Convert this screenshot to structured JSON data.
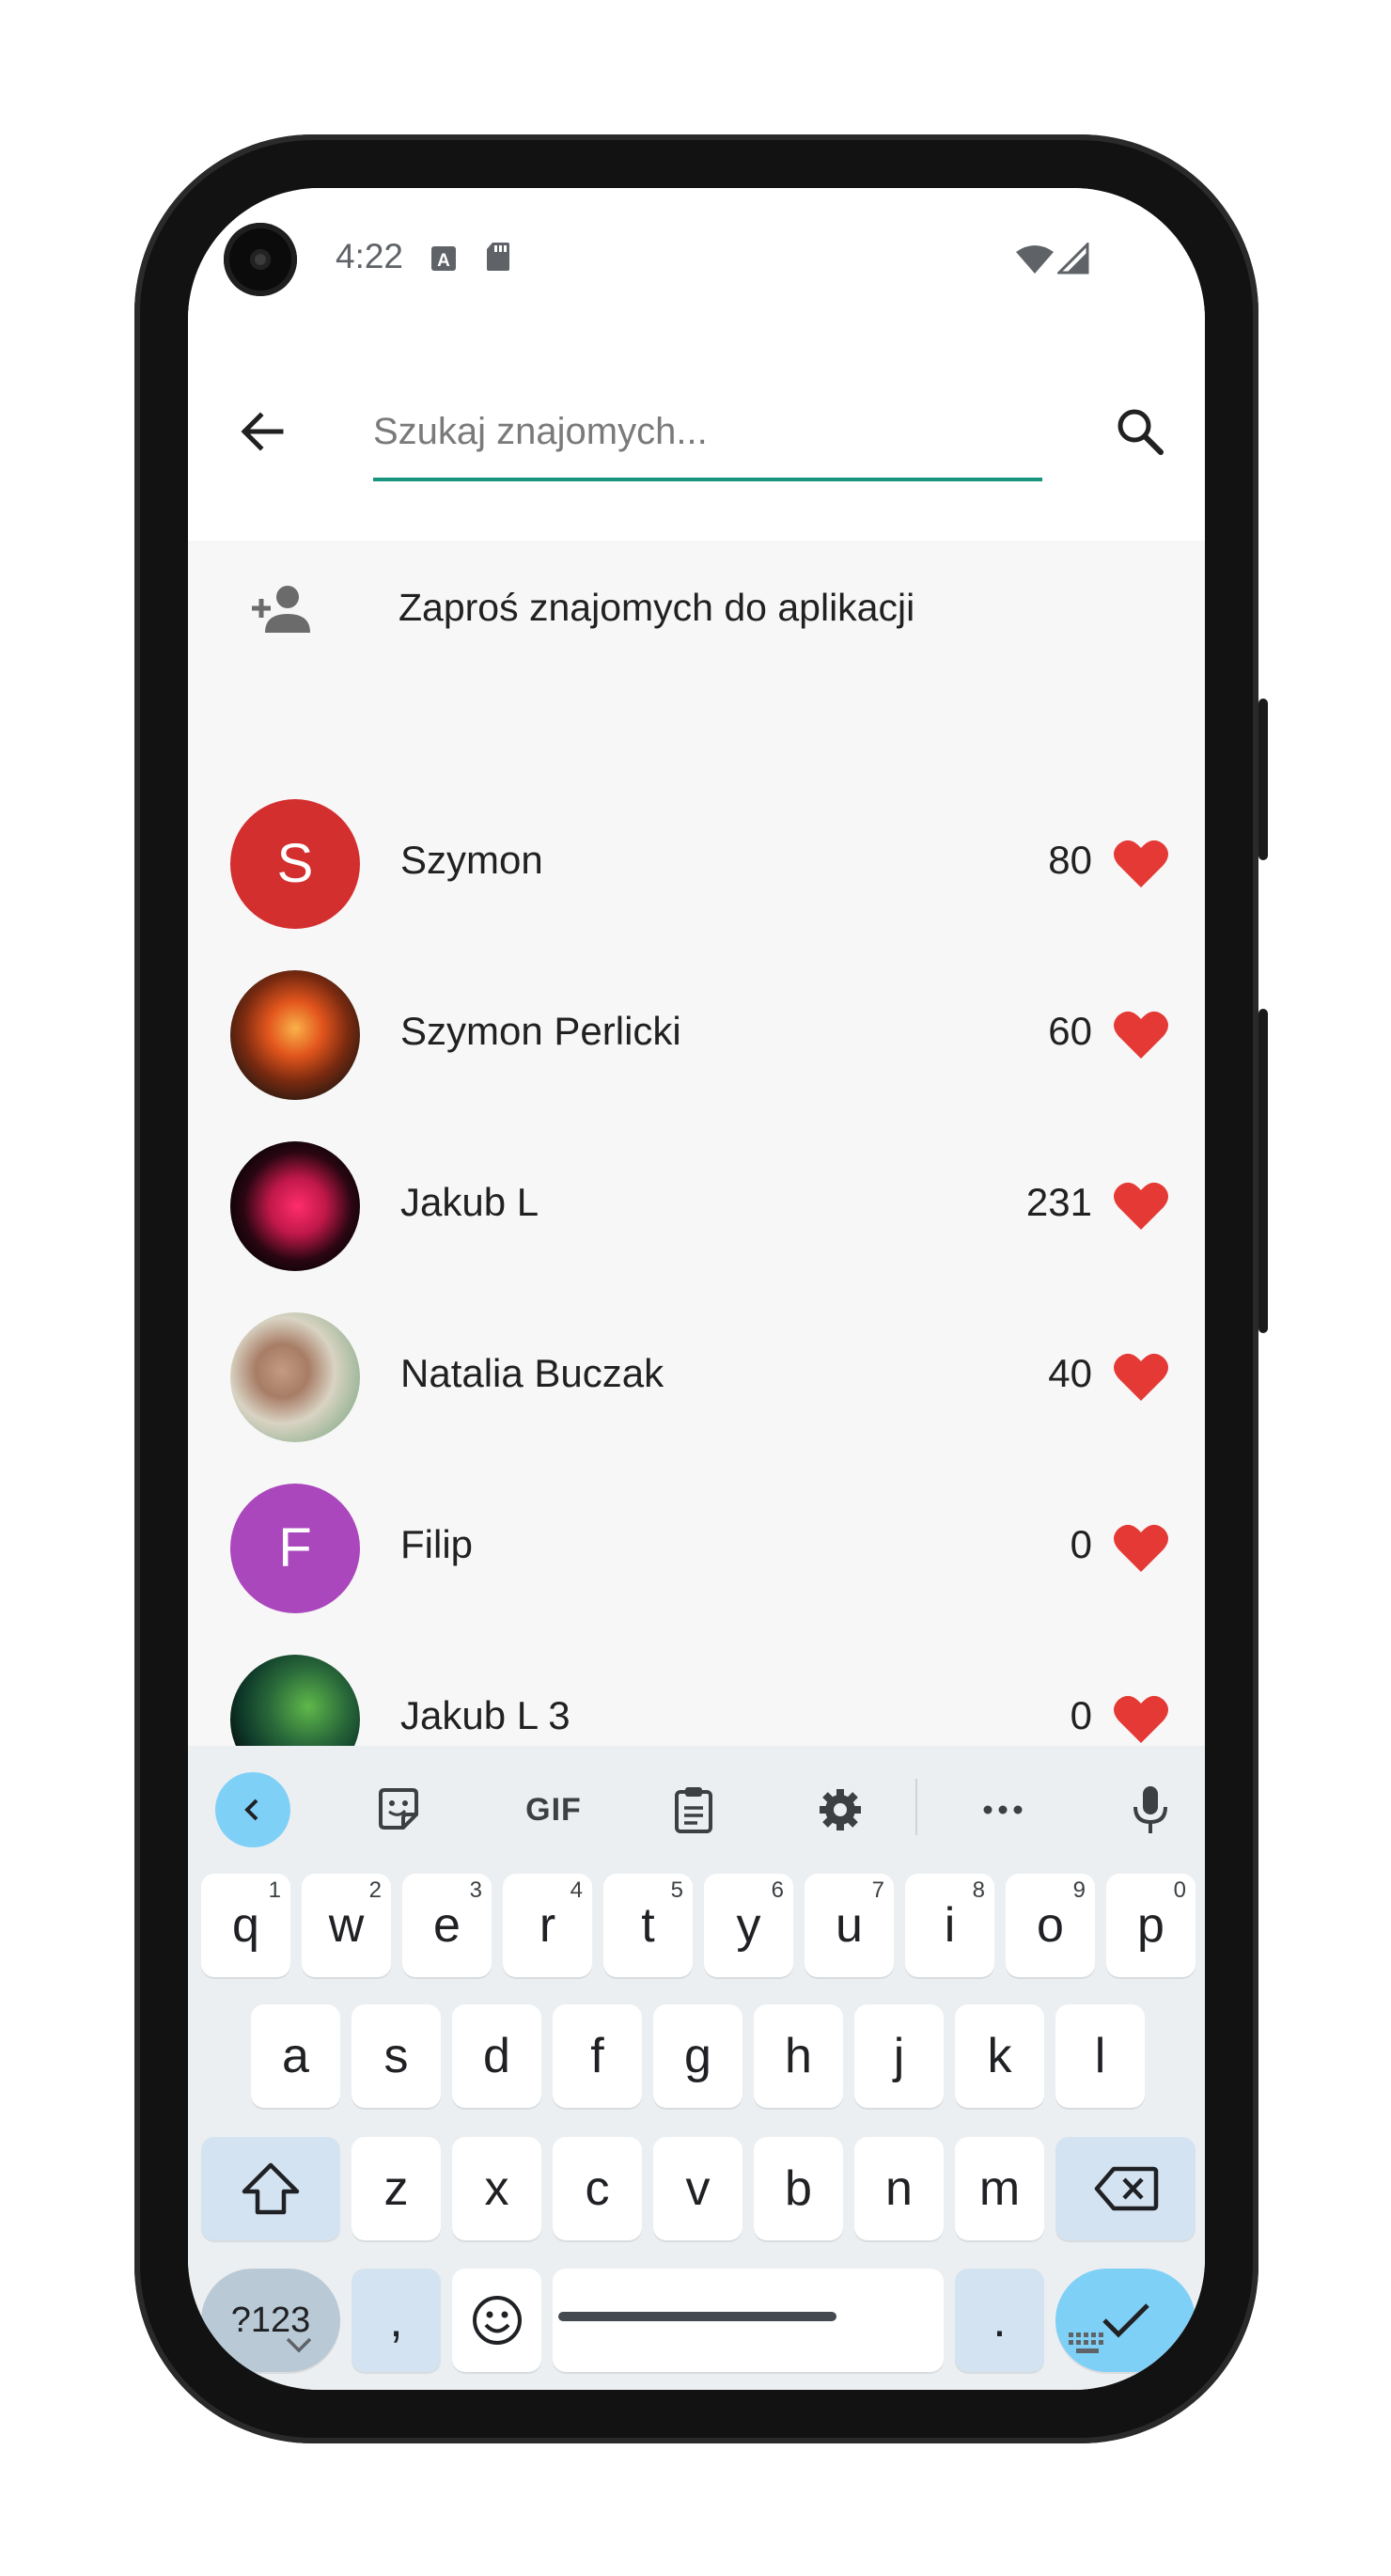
{
  "status_bar": {
    "time": "4:22"
  },
  "search": {
    "placeholder": "Szukaj znajomych...",
    "value": ""
  },
  "invite": {
    "label": "Zaproś znajomych do aplikacji"
  },
  "friends": [
    {
      "name": "Szymon",
      "score": "80",
      "avatar_letter": "S",
      "avatar_color": "#d32f2f"
    },
    {
      "name": "Szymon Perlicki",
      "score": "60",
      "avatar_letter": "",
      "avatar_color": "#7a2a10"
    },
    {
      "name": "Jakub L",
      "score": "231",
      "avatar_letter": "",
      "avatar_color": "#1a0a12"
    },
    {
      "name": "Natalia Buczak",
      "score": "40",
      "avatar_letter": "",
      "avatar_color": "#c9b9a4"
    },
    {
      "name": "Filip",
      "score": "0",
      "avatar_letter": "F",
      "avatar_color": "#ab47bc"
    },
    {
      "name": "Jakub L 3",
      "score": "0",
      "avatar_letter": "",
      "avatar_color": "#0f3b2a"
    }
  ],
  "keyboard": {
    "toolbar": [
      "collapse",
      "sticker",
      "gif",
      "clipboard",
      "settings",
      "more",
      "mic"
    ],
    "gif_label": "GIF",
    "row1": [
      {
        "k": "q",
        "h": "1"
      },
      {
        "k": "w",
        "h": "2"
      },
      {
        "k": "e",
        "h": "3"
      },
      {
        "k": "r",
        "h": "4"
      },
      {
        "k": "t",
        "h": "5"
      },
      {
        "k": "y",
        "h": "6"
      },
      {
        "k": "u",
        "h": "7"
      },
      {
        "k": "i",
        "h": "8"
      },
      {
        "k": "o",
        "h": "9"
      },
      {
        "k": "p",
        "h": "0"
      }
    ],
    "row2": [
      "a",
      "s",
      "d",
      "f",
      "g",
      "h",
      "j",
      "k",
      "l"
    ],
    "row3": [
      "z",
      "x",
      "c",
      "v",
      "b",
      "n",
      "m"
    ],
    "sym_label": "?123",
    "comma": ",",
    "period": "."
  },
  "colors": {
    "accent": "#17937e",
    "heart": "#e53935",
    "key_blue": "#7fd0f7"
  }
}
